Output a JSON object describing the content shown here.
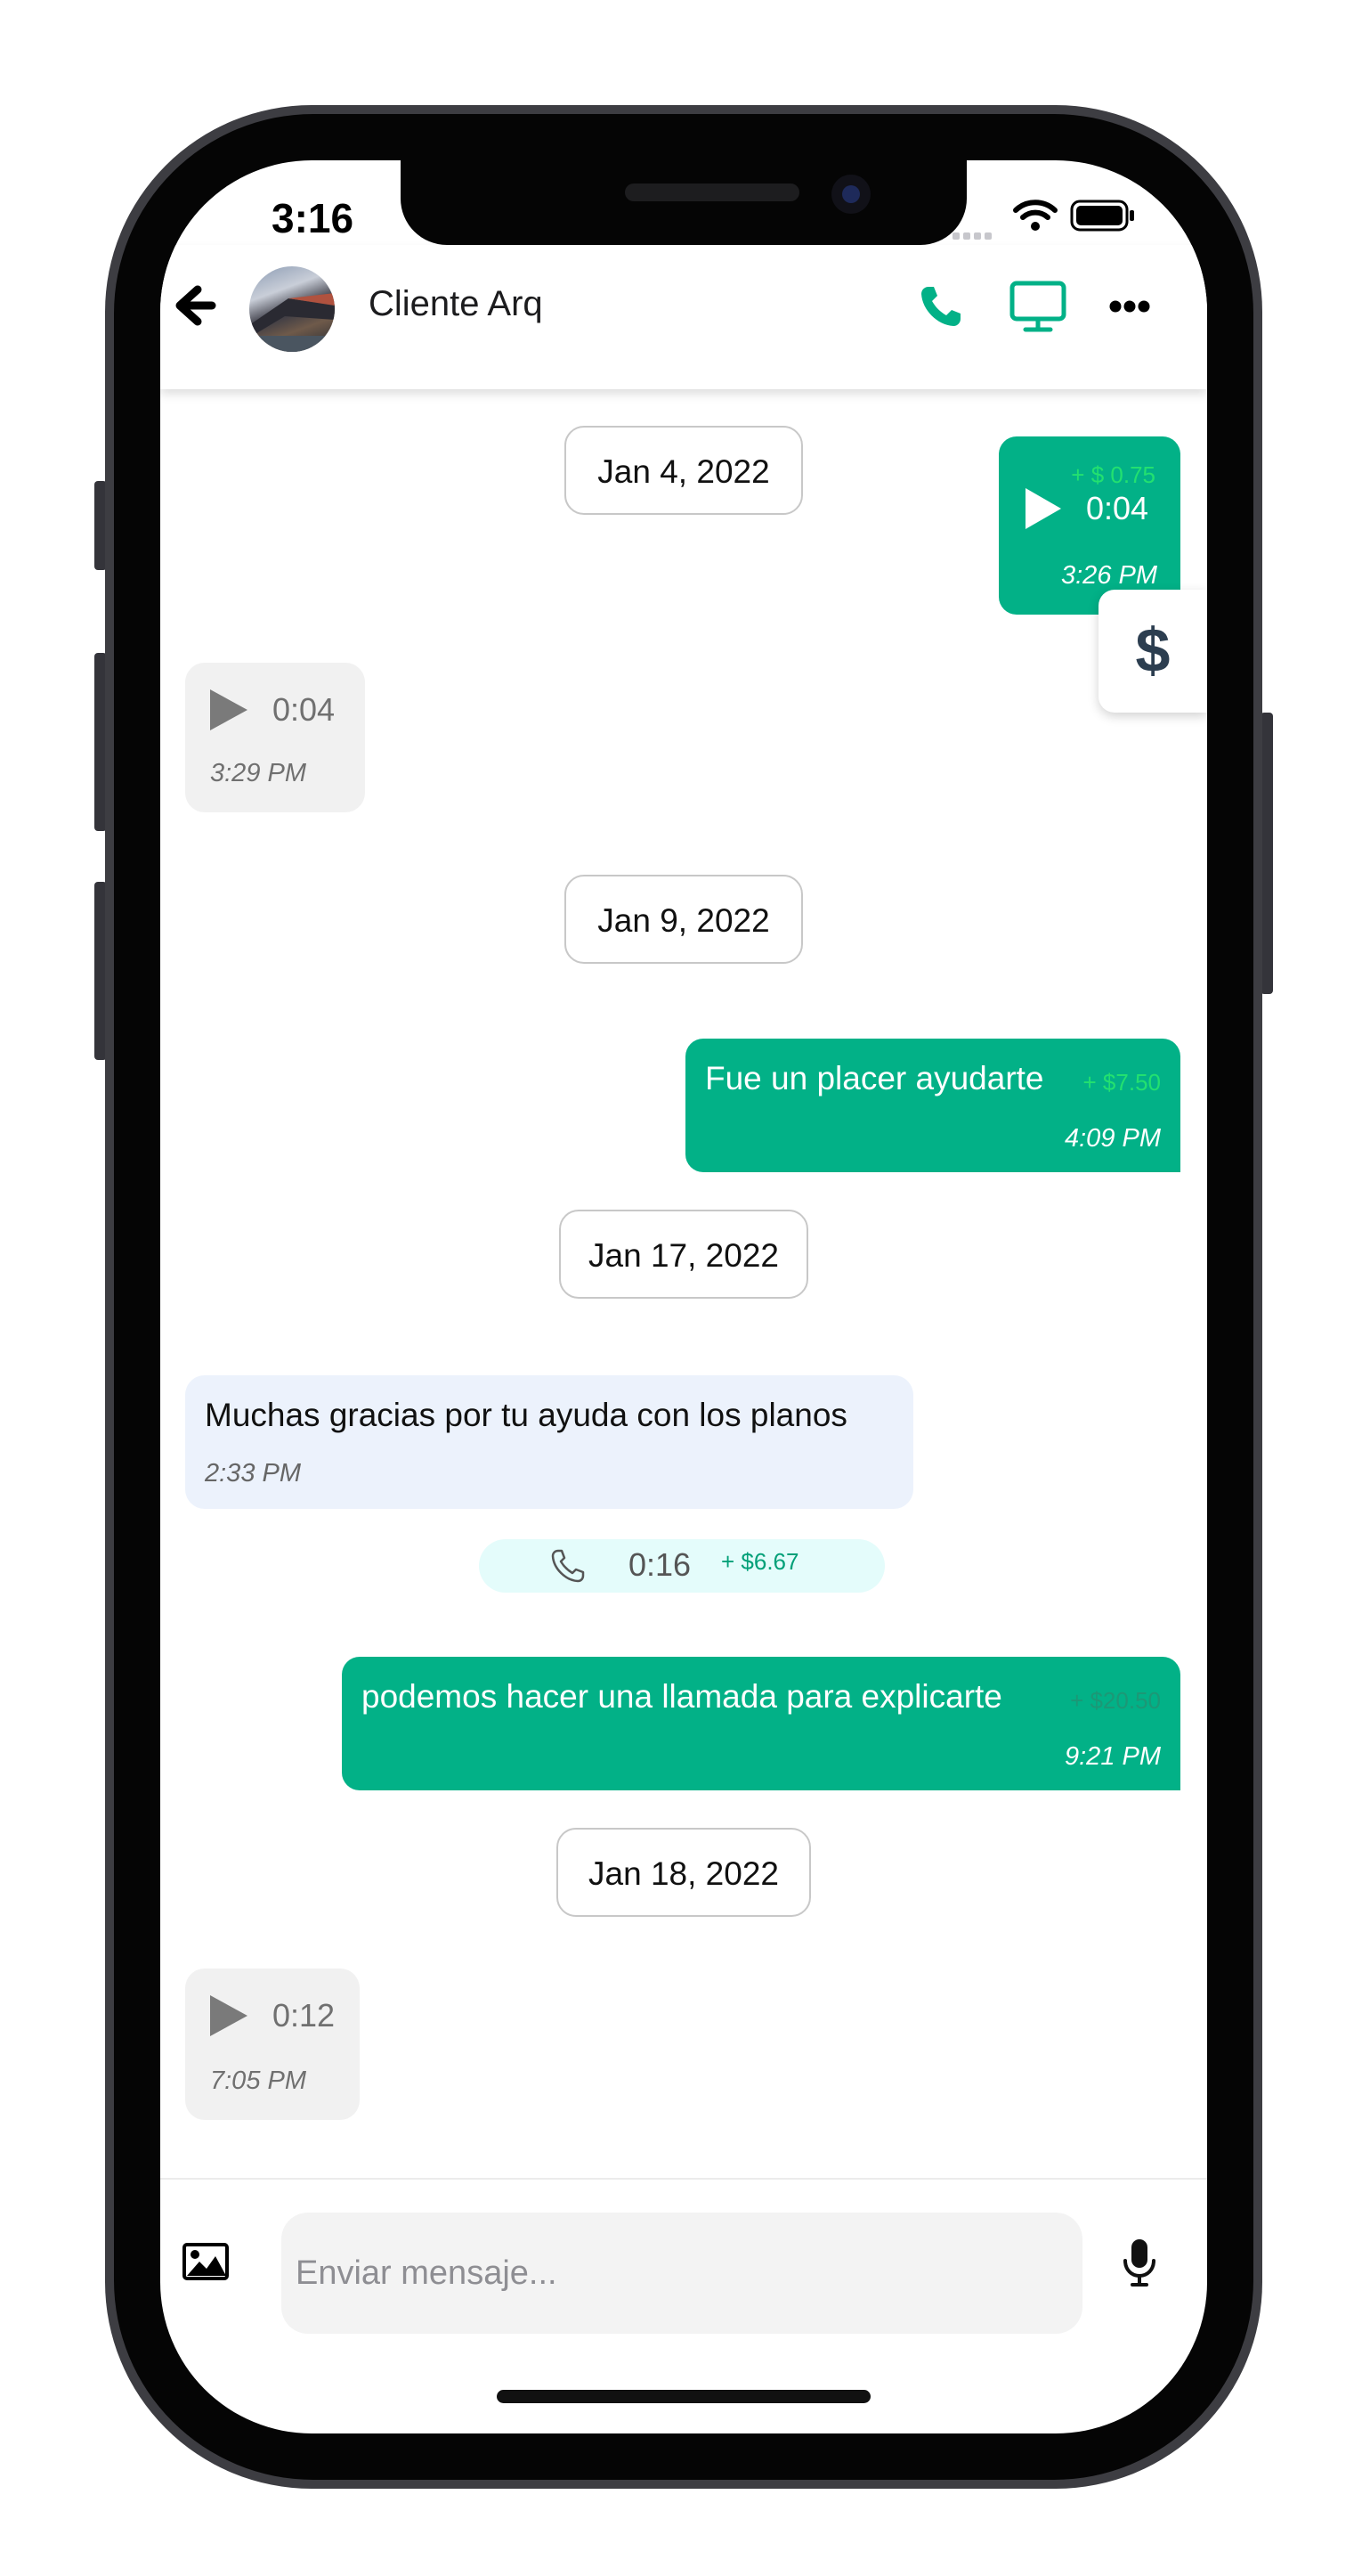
{
  "status_bar": {
    "time": "3:16"
  },
  "header": {
    "contact_name": "Cliente Arq",
    "icons": {
      "back": "arrow-left-icon",
      "call": "phone-icon",
      "video": "monitor-icon",
      "more": "more-icon"
    }
  },
  "colors": {
    "accent": "#02b187",
    "price_light": "#23e070",
    "incoming_blue": "#ecf2fc",
    "call_bg": "#e4fcfb"
  },
  "chat": {
    "dates": [
      "Jan 4, 2022",
      "Jan 9, 2022",
      "Jan 17, 2022",
      "Jan 18, 2022"
    ],
    "messages": [
      {
        "type": "audio",
        "direction": "out",
        "duration": "0:04",
        "price": "+ $ 0.75",
        "time": "3:26 PM"
      },
      {
        "type": "audio",
        "direction": "in",
        "duration": "0:04",
        "time": "3:29 PM"
      },
      {
        "type": "text",
        "direction": "out",
        "text": "Fue un placer ayudarte",
        "price": "+ $7.50",
        "time": "4:09 PM"
      },
      {
        "type": "text",
        "direction": "in",
        "text": "Muchas gracias por tu ayuda con los planos",
        "time": "2:33 PM"
      },
      {
        "type": "call",
        "duration": "0:16",
        "price": "+ $6.67"
      },
      {
        "type": "text",
        "direction": "out",
        "text": "podemos hacer una llamada para explicarte",
        "price": "+ $20.50",
        "time": "9:21 PM"
      },
      {
        "type": "audio",
        "direction": "in",
        "duration": "0:12",
        "time": "7:05 PM"
      }
    ],
    "tip_button_symbol": "$"
  },
  "input": {
    "placeholder": "Enviar mensaje...",
    "icons": {
      "attach": "image-icon",
      "mic": "microphone-icon"
    }
  }
}
